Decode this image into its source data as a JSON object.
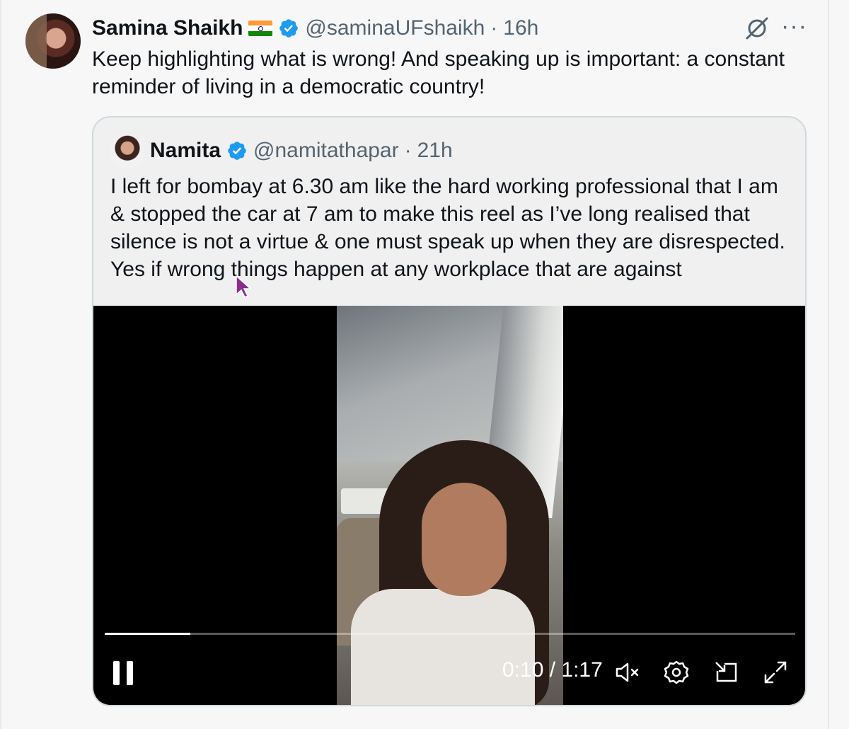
{
  "tweet": {
    "author_name": "Samina Shaikh",
    "author_handle": "@saminaUFshaikh",
    "time": "16h",
    "separator": "·",
    "text": "Keep highlighting what is wrong! And speaking up is important: a constant reminder of living in a democratic country!",
    "more_label": "···"
  },
  "quote": {
    "author_name": "Namita",
    "author_handle": "@namitathapar",
    "time": "21h",
    "separator": "·",
    "text": "I left for bombay at 6.30 am like the hard working professional that I am & stopped the car at 7 am to make this reel as I’ve long realised that silence is not a virtue & one must speak up when they are disrespected. Yes if wrong things happen at any workplace that are against"
  },
  "video": {
    "current_time": "0:10",
    "duration": "1:17",
    "time_separator": " / ",
    "progress": 0.124,
    "muted": true
  },
  "icons": {
    "verified": "verified-badge-icon",
    "flag": "india-flag-icon",
    "grok": "grok-icon",
    "more": "more-icon",
    "pause": "pause-icon",
    "mute": "mute-icon",
    "settings": "settings-icon",
    "pip": "picture-in-picture-icon",
    "fullscreen": "fullscreen-icon"
  },
  "colors": {
    "verified_blue": "#1d9bf0",
    "secondary_text": "#536471",
    "flag_saffron": "#ff9933",
    "flag_green": "#138808",
    "flag_chakra": "#000080"
  }
}
